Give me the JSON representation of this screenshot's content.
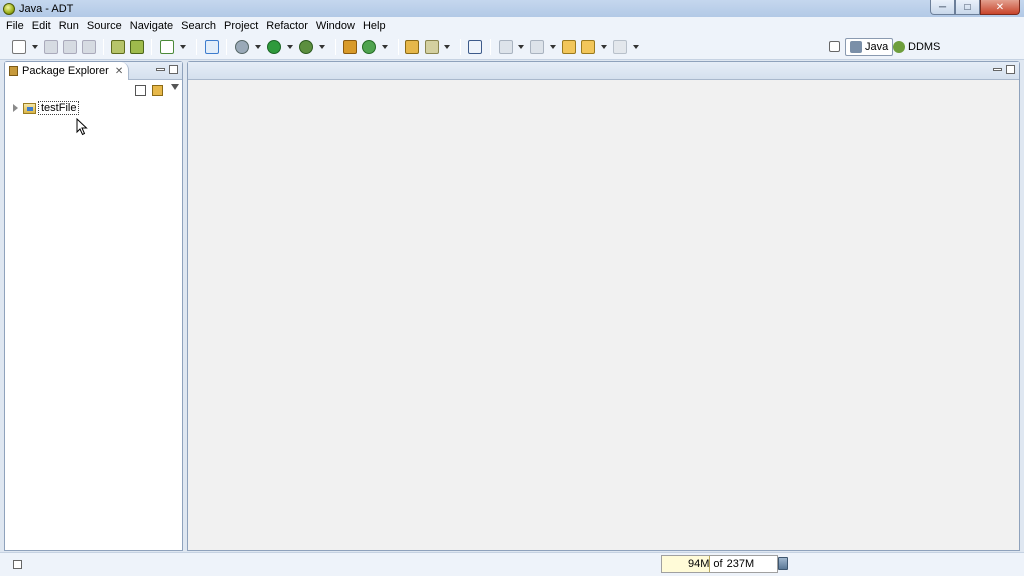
{
  "window": {
    "title": "Java - ADT",
    "minimize": "─",
    "maximize": "□",
    "close": "✕"
  },
  "menu": [
    "File",
    "Edit",
    "Run",
    "Source",
    "Navigate",
    "Search",
    "Project",
    "Refactor",
    "Window",
    "Help"
  ],
  "perspectives": {
    "java": "Java",
    "ddms": "DDMS"
  },
  "package_explorer": {
    "title": "Package Explorer",
    "close": "✕",
    "project": "testFile"
  },
  "status": {
    "heap_used": "94M",
    "heap_of": "of",
    "heap_total": "237M"
  },
  "colors": {
    "accent": "#3d7ccd",
    "panel_border": "#8fa2bc",
    "chrome": "#eef3fa"
  }
}
